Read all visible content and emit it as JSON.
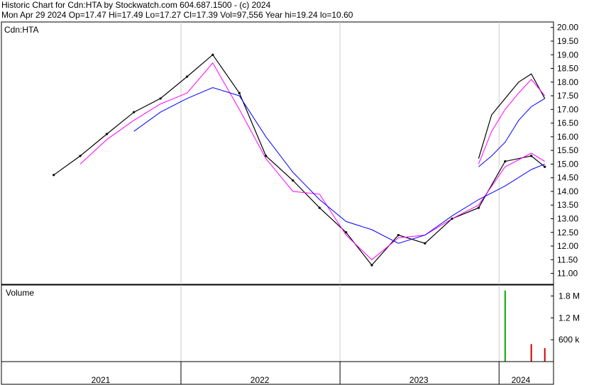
{
  "header": {
    "line1": "Historic Chart for Cdn:HTA by Stockwatch.com 604.687.1500 - (c) 2024",
    "line2": "Mon Apr 29 2024   Op=17.47   Hi=17.49   Lo=17.27   Cl=17.39   Vol=97,556   Year hi=19.24   lo=10.60"
  },
  "chart_data": [
    {
      "type": "line",
      "title": "Cdn:HTA",
      "ylim": [
        10.6,
        20.2
      ],
      "y_ticks": [
        "20.00",
        "19.50",
        "19.00",
        "18.50",
        "18.00",
        "17.50",
        "17.00",
        "16.50",
        "16.00",
        "15.50",
        "15.00",
        "14.50",
        "14.00",
        "13.50",
        "13.00",
        "12.50",
        "12.00",
        "11.50",
        "11.00"
      ],
      "x": [
        "2021-03",
        "2021-05",
        "2021-07",
        "2021-09",
        "2021-11",
        "2022-01",
        "2022-03",
        "2022-05",
        "2022-07",
        "2022-09",
        "2022-11",
        "2023-01",
        "2023-03",
        "2023-05",
        "2023-07",
        "2023-09",
        "2023-11",
        "2024-01",
        "2024-03",
        "2024-04"
      ],
      "series": [
        {
          "values": [
            14.6,
            15.3,
            16.1,
            16.9,
            17.4,
            18.2,
            19.0,
            17.6,
            15.3,
            14.4,
            13.4,
            12.5,
            11.3,
            12.4,
            12.1,
            13.0,
            13.4,
            15.1,
            15.3,
            14.9
          ]
        },
        {
          "values": [
            null,
            15.0,
            15.9,
            16.6,
            17.2,
            17.6,
            18.7,
            17.0,
            15.2,
            14.0,
            13.9,
            12.4,
            11.5,
            12.3,
            12.4,
            13.0,
            13.5,
            14.9,
            15.4,
            15.1
          ]
        },
        {
          "values": [
            null,
            null,
            null,
            16.2,
            16.9,
            17.4,
            17.8,
            17.5,
            16.0,
            14.7,
            13.7,
            12.9,
            12.6,
            12.1,
            12.4,
            13.1,
            13.7,
            14.2,
            14.8,
            15.0
          ]
        }
      ],
      "series_colors": [
        "#000000",
        "#ff00ff",
        "#0000ff"
      ],
      "x2": [
        "2023-11",
        "2023-12",
        "2024-01",
        "2024-02",
        "2024-03",
        "2024-04"
      ],
      "series2": [
        {
          "values": [
            15.2,
            16.8,
            17.4,
            18.0,
            18.3,
            17.4
          ]
        },
        {
          "values": [
            15.0,
            16.2,
            17.0,
            17.6,
            18.1,
            17.5
          ]
        },
        {
          "values": [
            14.9,
            15.3,
            15.8,
            16.6,
            17.1,
            17.4
          ]
        }
      ]
    },
    {
      "type": "bar",
      "title": "Volume",
      "ylim": [
        0,
        2100000
      ],
      "y_ticks": [
        "1.8 M",
        "1.2 M",
        "600 k"
      ],
      "bar_colors": [
        "#00aa00",
        "#cc0000"
      ],
      "peaks": [
        {
          "date": "2024-01",
          "value": 1950000
        },
        {
          "date": "2024-03",
          "value": 480000
        },
        {
          "date": "2024-04",
          "value": 370000
        }
      ]
    }
  ],
  "x_axis": {
    "years": [
      "2021",
      "2022",
      "2023",
      "2024"
    ]
  }
}
